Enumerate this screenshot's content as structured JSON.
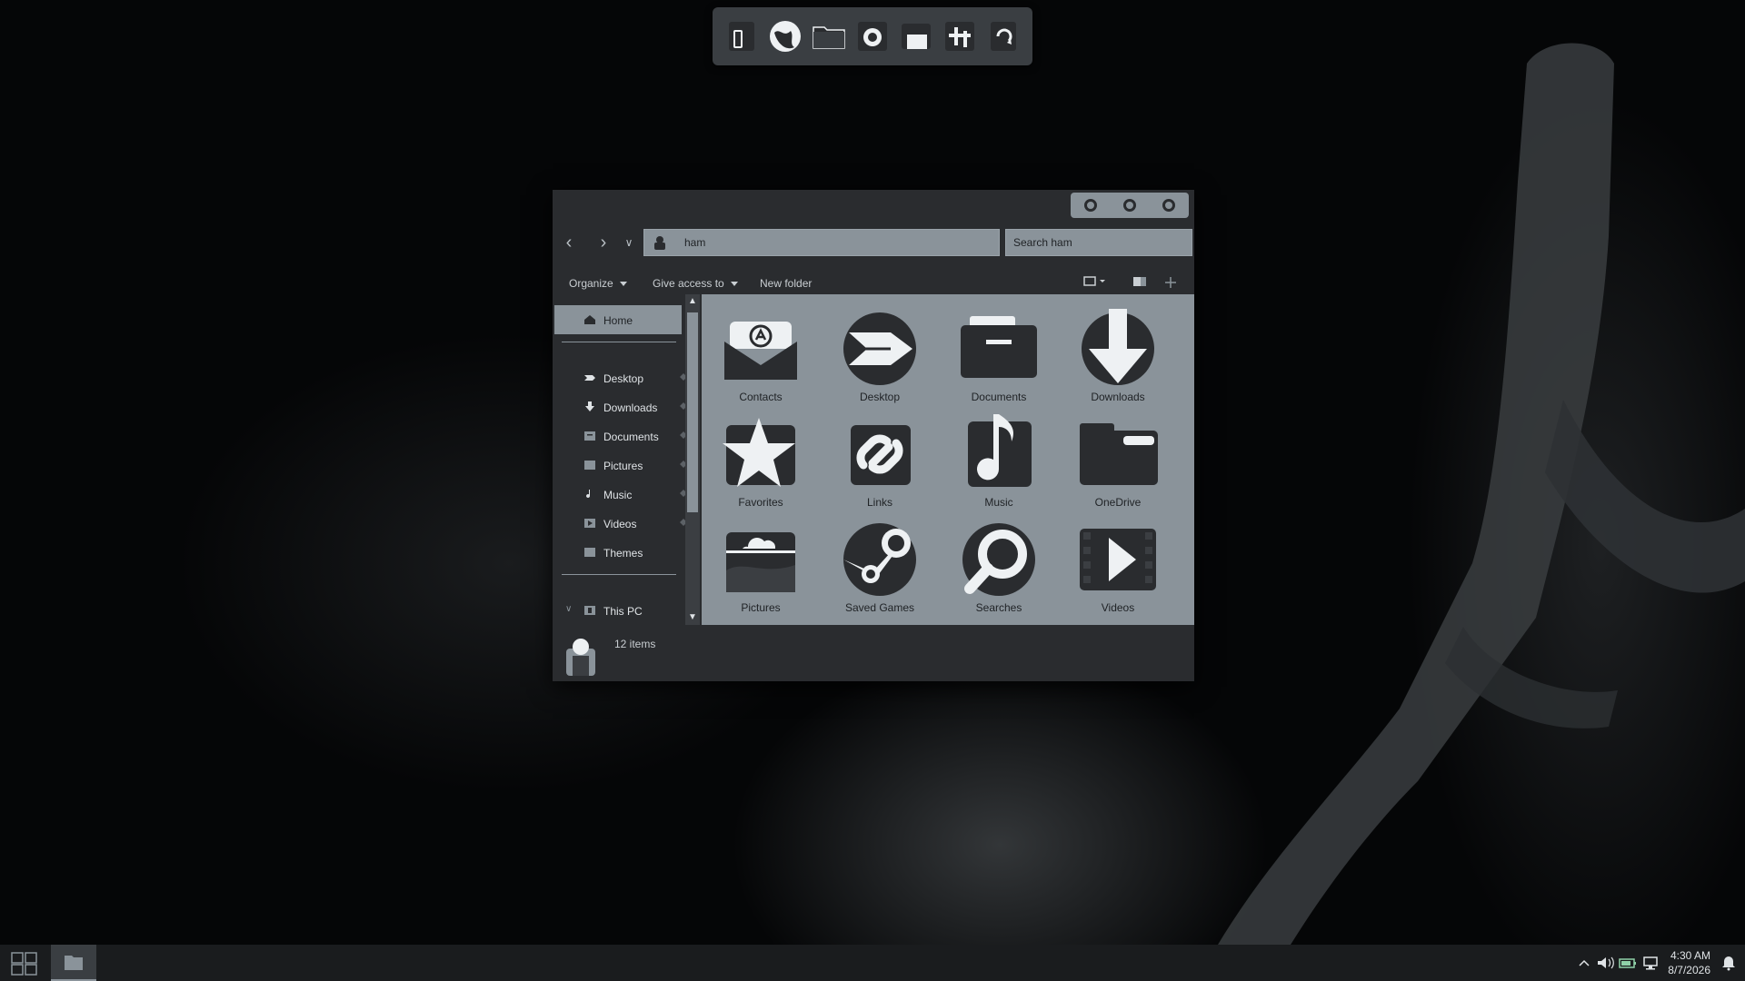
{
  "theme": {
    "accent": "#8a939a",
    "window_bg": "#2a2c2f",
    "desktop_bg": "#050607",
    "text_dark": "#1f2225"
  },
  "dock": {
    "items": [
      {
        "name": "phone-icon"
      },
      {
        "name": "globe-icon"
      },
      {
        "name": "folder-icon"
      },
      {
        "name": "camera-icon"
      },
      {
        "name": "store-icon"
      },
      {
        "name": "settings-sliders-icon"
      },
      {
        "name": "recycle-bin-icon"
      }
    ]
  },
  "explorer": {
    "address": "ham",
    "search_placeholder": "Search ham",
    "commands": {
      "organize": "Organize",
      "give_access": "Give access to",
      "new_folder": "New folder"
    },
    "nav": {
      "home": "Home",
      "quick": [
        "Desktop",
        "Downloads",
        "Documents",
        "Pictures",
        "Music",
        "Videos",
        "Themes"
      ],
      "this_pc": "This PC"
    },
    "items": [
      {
        "label": "Contacts",
        "icon": "contacts-icon"
      },
      {
        "label": "Desktop",
        "icon": "desktop-arrow-icon"
      },
      {
        "label": "Documents",
        "icon": "documents-folder-icon"
      },
      {
        "label": "Downloads",
        "icon": "download-arrow-icon"
      },
      {
        "label": "Favorites",
        "icon": "star-icon"
      },
      {
        "label": "Links",
        "icon": "link-icon"
      },
      {
        "label": "Music",
        "icon": "music-note-icon"
      },
      {
        "label": "OneDrive",
        "icon": "onedrive-folder-icon"
      },
      {
        "label": "Pictures",
        "icon": "pictures-icon"
      },
      {
        "label": "Saved Games",
        "icon": "steam-icon"
      },
      {
        "label": "Searches",
        "icon": "search-icon"
      },
      {
        "label": "Videos",
        "icon": "play-icon"
      }
    ],
    "status": "12 items"
  },
  "taskbar": {
    "time": "4:30 AM",
    "date": "8/7/2026"
  }
}
